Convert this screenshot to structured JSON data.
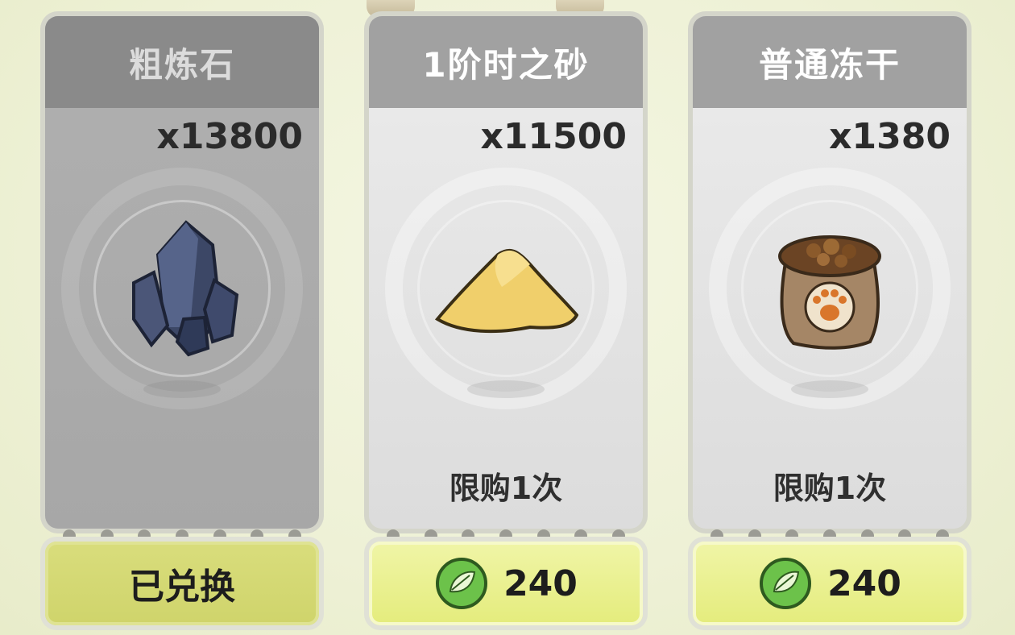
{
  "shop": {
    "items": [
      {
        "name": "粗炼石",
        "quantity": "x13800",
        "limit": "",
        "button": "已兑换",
        "state": "redeemed"
      },
      {
        "name": "1阶时之砂",
        "quantity": "x11500",
        "limit": "限购1次",
        "price": "240",
        "state": "available"
      },
      {
        "name": "普通冻干",
        "quantity": "x1380",
        "limit": "限购1次",
        "price": "240",
        "state": "available"
      }
    ],
    "currency_icon": "leaf-orb-icon"
  }
}
